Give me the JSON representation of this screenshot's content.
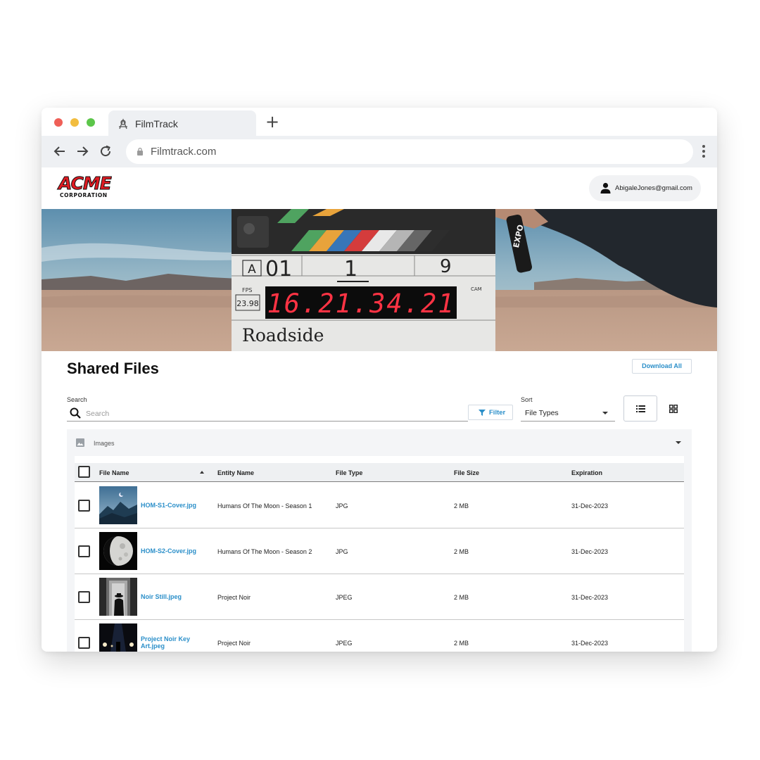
{
  "browser": {
    "tab_title": "FilmTrack",
    "new_tab_symbol": "+",
    "url": "Filmtrack.com"
  },
  "header": {
    "logo_text": "ACME",
    "logo_subtext": "CORPORATION",
    "user_email": "AbigaleJones@gmail.com"
  },
  "hero": {
    "clapper_roll": "A",
    "clapper_scene": "01",
    "clapper_take_scene": "1",
    "clapper_take": "9",
    "clapper_fps_label": "FPS",
    "clapper_fps": "23.98",
    "clapper_timecode": "16.21.34.21",
    "clapper_cam_label": "CAM",
    "clapper_title": "Roadside",
    "marker_text": "EXPO"
  },
  "page": {
    "title": "Shared Files",
    "download_all_label": "Download All"
  },
  "toolbar": {
    "search_label": "Search",
    "search_placeholder": "Search",
    "filter_label": "Filter",
    "sort_label": "Sort",
    "sort_value": "File Types"
  },
  "section": {
    "title": "Images"
  },
  "table": {
    "columns": [
      "File Name",
      "Entity Name",
      "File Type",
      "File Size",
      "Expiration"
    ],
    "sort_column": "File Name",
    "sort_direction": "ascending",
    "rows": [
      {
        "file_name": "HOM-S1-Cover.jpg",
        "entity": "Humans Of The Moon - Season 1",
        "type": "JPG",
        "size": "2 MB",
        "expiration": "31-Dec-2023",
        "checked": false
      },
      {
        "file_name": "HOM-S2-Cover.jpg",
        "entity": "Humans Of The Moon - Season 2",
        "type": "JPG",
        "size": "2 MB",
        "expiration": "31-Dec-2023",
        "checked": false
      },
      {
        "file_name": "Noir Still.jpeg",
        "entity": "Project Noir",
        "type": "JPEG",
        "size": "2 MB",
        "expiration": "31-Dec-2023",
        "checked": false
      },
      {
        "file_name": "Project Noir Key Art.jpeg",
        "entity": "Project Noir",
        "type": "JPEG",
        "size": "2 MB",
        "expiration": "31-Dec-2023",
        "checked": false
      }
    ]
  },
  "colors": {
    "link": "#2b8fc9",
    "logo_red": "#e01b22",
    "clapper_led": "#ff3344"
  }
}
